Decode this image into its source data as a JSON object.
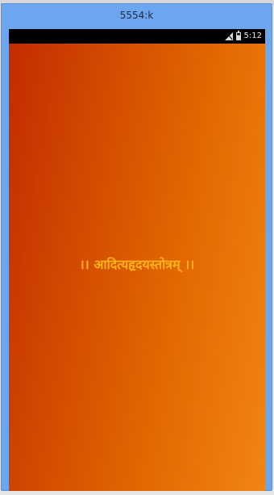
{
  "window": {
    "title": "5554:k"
  },
  "statusbar": {
    "icons": [
      "signal-icon",
      "battery-icon"
    ],
    "time": "5:12"
  },
  "splash": {
    "title": "।। आदित्यहृदयस्तोत्रम् ।।",
    "gradient_colors": [
      "#c22c00",
      "#d24a00",
      "#e46a00",
      "#ef8514"
    ],
    "title_color": "#ffb11c"
  }
}
